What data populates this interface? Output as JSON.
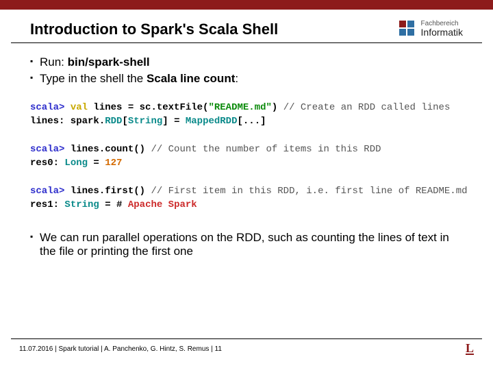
{
  "header": {
    "title": "Introduction to Spark's Scala Shell",
    "dept_small": "Fachbereich",
    "dept_large": "Informatik"
  },
  "bullets_top": [
    {
      "prefix": "Run: ",
      "bold": "bin/spark-shell",
      "suffix": ""
    },
    {
      "prefix": "Type in the shell the ",
      "bold": "Scala line count",
      "suffix": ":"
    }
  ],
  "code": {
    "l1_prompt": "scala> ",
    "l1_kw": "val",
    "l1_mid": " lines = sc.textFile(",
    "l1_str": "\"README.md\"",
    "l1_end": ") ",
    "l1_cmt": "// Create an RDD called lines",
    "l2_a": "lines: spark.",
    "l2_b": "RDD",
    "l2_c": "[",
    "l2_d": "String",
    "l2_e": "] = ",
    "l2_f": "MappedRDD",
    "l2_g": "[...]",
    "l3_prompt": "scala> ",
    "l3_body": "lines.count() ",
    "l3_cmt": "// Count the number of items in this RDD",
    "l4_a": "res0: ",
    "l4_b": "Long",
    "l4_c": " = ",
    "l4_d": "127",
    "l5_prompt": "scala> ",
    "l5_body": "lines.first() ",
    "l5_cmt": "// First item in this RDD, i.e. first line of README.md",
    "l6_a": "res1: ",
    "l6_b": "String",
    "l6_c": " = # ",
    "l6_d": "Apache Spark"
  },
  "bullets_bottom": [
    {
      "text": "We can run parallel operations on the RDD, such as counting the lines of text in the file or printing the first one"
    }
  ],
  "footer": {
    "text": "11.07.2016  |  Spark tutorial |   A. Panchenko, G. Hintz, S. Remus   |  11",
    "logo": "L"
  }
}
